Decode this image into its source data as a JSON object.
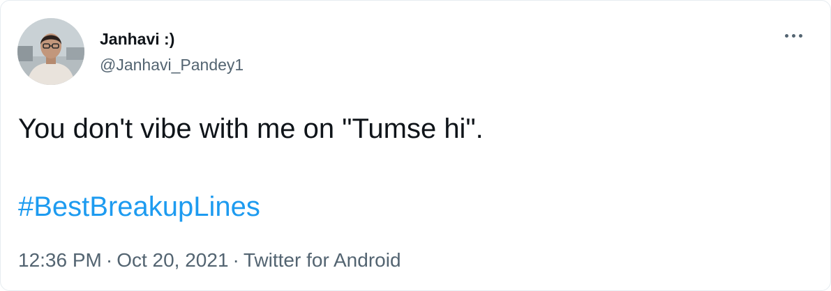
{
  "tweet": {
    "author": {
      "display_name": "Janhavi :)",
      "handle": "@Janhavi_Pandey1",
      "avatar_icon": "profile-photo"
    },
    "more_icon": "more-horizontal-icon",
    "text": "You don't vibe with me on \"Tumse hi\".",
    "hashtag": "#BestBreakupLines",
    "time": "12:36 PM",
    "separator": "·",
    "date": "Oct 20, 2021",
    "source": "Twitter for Android"
  },
  "colors": {
    "text": "#0f1419",
    "secondary": "#536471",
    "link": "#1d9bf0",
    "border": "#e6ecf0"
  }
}
